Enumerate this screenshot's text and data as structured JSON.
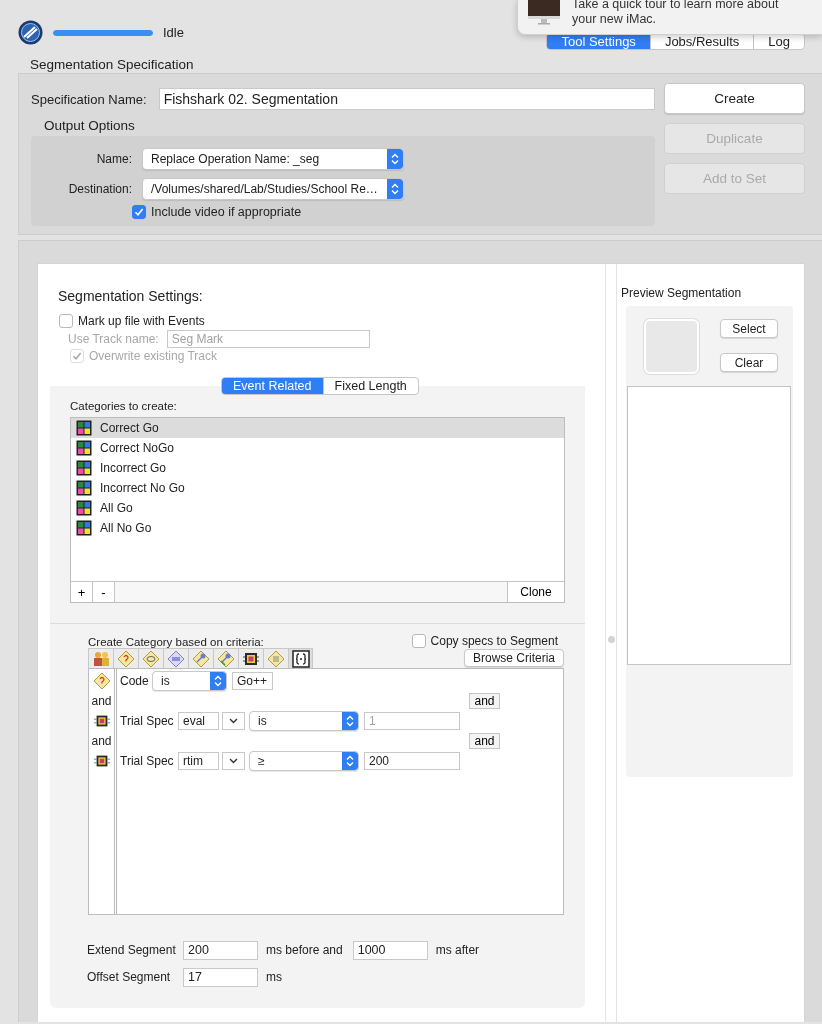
{
  "status": {
    "text": "Idle",
    "level": 1
  },
  "tabs": [
    {
      "label": "Tool Settings",
      "selected": true
    },
    {
      "label": "Jobs/Results",
      "selected": false
    },
    {
      "label": "Log",
      "selected": false
    }
  ],
  "notification": {
    "lines": [
      "Take a quick tour to learn more about",
      "your new iMac."
    ]
  },
  "specification": {
    "title": "Segmentation Specification",
    "name_label": "Specification Name:",
    "name_value": "Fishshark 02. Segmentation",
    "output_options": {
      "title": "Output Options",
      "name_label": "Name:",
      "name_value": "Replace Operation Name: _seg",
      "destination_label": "Destination:",
      "destination_value": "/Volumes/shared/Lab/Studies/School Re…",
      "include_video": {
        "label": "Include video if appropriate",
        "checked": true
      }
    },
    "buttons": [
      {
        "label": "Create",
        "disabled": false
      },
      {
        "label": "Duplicate",
        "disabled": true
      },
      {
        "label": "Add to Set",
        "disabled": true
      }
    ]
  },
  "segmentation_settings": {
    "title": "Segmentation Settings:",
    "mark_up": {
      "label": "Mark up file with Events",
      "checked": false
    },
    "track_name": {
      "label": "Use Track name:",
      "value": "Seg Mark",
      "disabled": true
    },
    "overwrite": {
      "label": "Overwrite existing Track",
      "checked": true,
      "disabled": true
    },
    "modes": [
      {
        "label": "Event Related",
        "selected": true
      },
      {
        "label": "Fixed Length",
        "selected": false
      }
    ],
    "categories": {
      "title": "Categories to create:",
      "items": [
        {
          "label": "Correct Go",
          "selected": true
        },
        {
          "label": "Correct NoGo",
          "selected": false
        },
        {
          "label": "Incorrect Go",
          "selected": false
        },
        {
          "label": "Incorrect No Go",
          "selected": false
        },
        {
          "label": "All Go",
          "selected": false
        },
        {
          "label": "All No Go",
          "selected": false
        }
      ],
      "add": "+",
      "remove": "-",
      "clone": "Clone"
    },
    "criteria": {
      "title": "Create Category based on criteria:",
      "copy_specs": {
        "label": "Copy specs to Segment",
        "checked": false
      },
      "browse": "Browse Criteria",
      "rows": [
        {
          "kind": "code",
          "label": "Code",
          "operator": "is",
          "value": "Go++"
        },
        {
          "kind": "connector",
          "text": "and",
          "button": "and"
        },
        {
          "kind": "trial_spec",
          "label": "Trial Spec",
          "field": "eval",
          "operator": "is",
          "value": "1",
          "disabled": true
        },
        {
          "kind": "connector",
          "text": "and",
          "button": "and"
        },
        {
          "kind": "trial_spec",
          "label": "Trial Spec",
          "field": "rtim",
          "operator": "≥",
          "value": "200",
          "disabled": false
        }
      ]
    },
    "extend": {
      "label": "Extend Segment",
      "before": "200",
      "before_label": "ms before and",
      "after": "1000",
      "after_label": "ms after"
    },
    "offset": {
      "label": "Offset Segment",
      "value": "17",
      "unit": "ms"
    }
  },
  "preview": {
    "title": "Preview Segmentation",
    "buttons": [
      "Select",
      "Clear"
    ]
  }
}
